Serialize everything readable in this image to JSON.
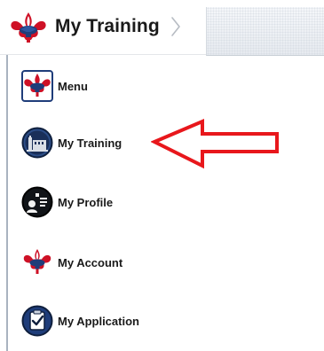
{
  "header": {
    "title": "My Training",
    "logo_icon": "bsa-fleur-de-lis-icon",
    "chevron_icon": "chevron-right-icon"
  },
  "sidebar": {
    "items": [
      {
        "label": "Menu",
        "icon": "bsa-fleur-de-lis-icon"
      },
      {
        "label": "My Training",
        "icon": "training-building-icon"
      },
      {
        "label": "My Profile",
        "icon": "profile-icon"
      },
      {
        "label": "My Account",
        "icon": "bsa-fleur-de-lis-icon"
      },
      {
        "label": "My Application",
        "icon": "application-checklist-icon"
      }
    ]
  },
  "annotation": {
    "icon": "red-arrow-left-icon",
    "color": "#e8171c"
  },
  "colors": {
    "brand_navy": "#1f3d7a",
    "brand_red": "#ce1126",
    "text": "#1a1a1a"
  }
}
